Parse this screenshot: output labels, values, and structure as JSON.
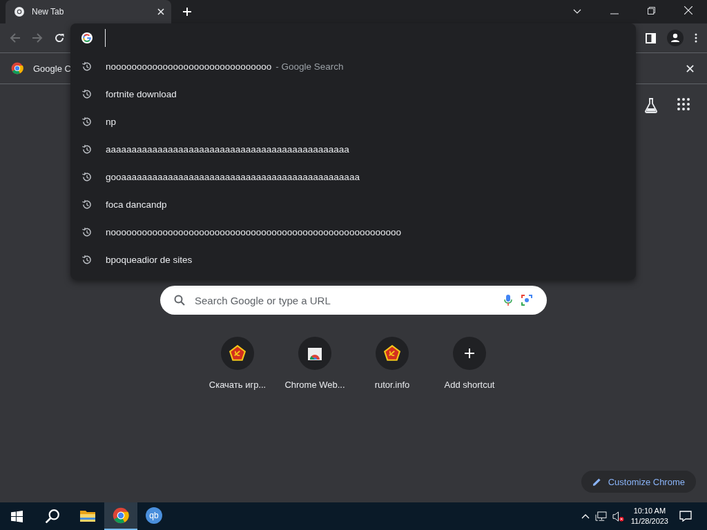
{
  "tabs": [
    {
      "title": "New Tab",
      "selected": true
    }
  ],
  "bookmarks_bar": {
    "items": [
      {
        "label": "Google C"
      }
    ]
  },
  "omnibox_dropdown": {
    "suggestions": [
      {
        "text": "nooooooooooooooooooooooooooooooo",
        "suffix": "- Google Search"
      },
      {
        "text": "fortnite download"
      },
      {
        "text": "np"
      },
      {
        "text": "aaaaaaaaaaaaaaaaaaaaaaaaaaaaaaaaaaaaaaaaaaaaaaa"
      },
      {
        "text": "gooaaaaaaaaaaaaaaaaaaaaaaaaaaaaaaaaaaaaaaaaaaaaaa"
      },
      {
        "text": "foca dancandp"
      },
      {
        "text": "noooooooooooooooooooooooooooooooooooooooooooooooooooooooo"
      },
      {
        "text": "bpoqueadior de sites"
      }
    ]
  },
  "search_box": {
    "placeholder": "Search Google or type a URL"
  },
  "shortcuts": [
    {
      "label": "Скачать игр...",
      "kind": "emblem"
    },
    {
      "label": "Chrome Web...",
      "kind": "store"
    },
    {
      "label": "rutor.info",
      "kind": "emblem"
    },
    {
      "label": "Add shortcut",
      "kind": "add"
    }
  ],
  "customize_button": {
    "label": "Customize Chrome"
  },
  "taskbar": {
    "apps": [
      {
        "kind": "explorer",
        "selected": false
      },
      {
        "kind": "chrome",
        "selected": true
      },
      {
        "kind": "qbittorrent",
        "label": "qb",
        "selected": false
      }
    ],
    "time": "10:10 AM",
    "date": "11/28/2023"
  }
}
